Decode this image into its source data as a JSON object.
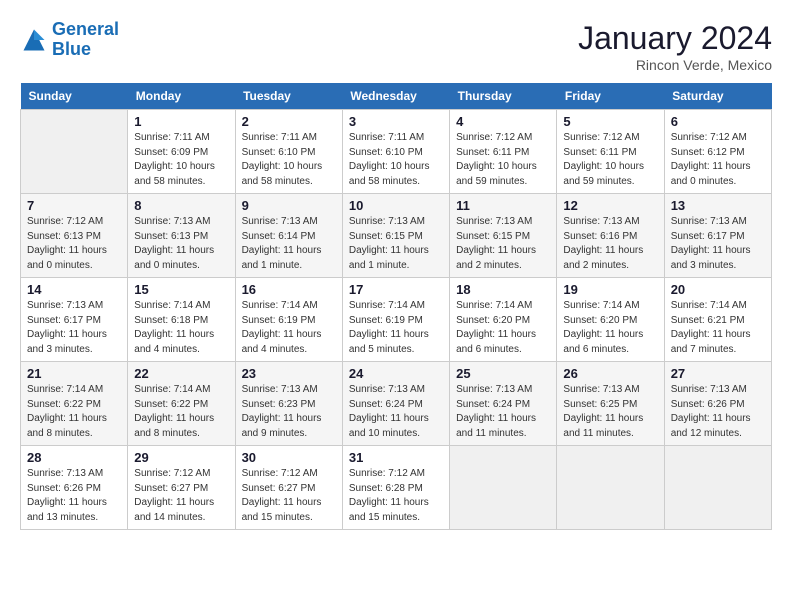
{
  "header": {
    "logo_line1": "General",
    "logo_line2": "Blue",
    "month": "January 2024",
    "location": "Rincon Verde, Mexico"
  },
  "days_of_week": [
    "Sunday",
    "Monday",
    "Tuesday",
    "Wednesday",
    "Thursday",
    "Friday",
    "Saturday"
  ],
  "weeks": [
    [
      {
        "day": "",
        "empty": true
      },
      {
        "day": "1",
        "sunrise": "7:11 AM",
        "sunset": "6:09 PM",
        "daylight": "10 hours and 58 minutes."
      },
      {
        "day": "2",
        "sunrise": "7:11 AM",
        "sunset": "6:10 PM",
        "daylight": "10 hours and 58 minutes."
      },
      {
        "day": "3",
        "sunrise": "7:11 AM",
        "sunset": "6:10 PM",
        "daylight": "10 hours and 58 minutes."
      },
      {
        "day": "4",
        "sunrise": "7:12 AM",
        "sunset": "6:11 PM",
        "daylight": "10 hours and 59 minutes."
      },
      {
        "day": "5",
        "sunrise": "7:12 AM",
        "sunset": "6:11 PM",
        "daylight": "10 hours and 59 minutes."
      },
      {
        "day": "6",
        "sunrise": "7:12 AM",
        "sunset": "6:12 PM",
        "daylight": "11 hours and 0 minutes."
      }
    ],
    [
      {
        "day": "7",
        "sunrise": "7:12 AM",
        "sunset": "6:13 PM",
        "daylight": "11 hours and 0 minutes."
      },
      {
        "day": "8",
        "sunrise": "7:13 AM",
        "sunset": "6:13 PM",
        "daylight": "11 hours and 0 minutes."
      },
      {
        "day": "9",
        "sunrise": "7:13 AM",
        "sunset": "6:14 PM",
        "daylight": "11 hours and 1 minute."
      },
      {
        "day": "10",
        "sunrise": "7:13 AM",
        "sunset": "6:15 PM",
        "daylight": "11 hours and 1 minute."
      },
      {
        "day": "11",
        "sunrise": "7:13 AM",
        "sunset": "6:15 PM",
        "daylight": "11 hours and 2 minutes."
      },
      {
        "day": "12",
        "sunrise": "7:13 AM",
        "sunset": "6:16 PM",
        "daylight": "11 hours and 2 minutes."
      },
      {
        "day": "13",
        "sunrise": "7:13 AM",
        "sunset": "6:17 PM",
        "daylight": "11 hours and 3 minutes."
      }
    ],
    [
      {
        "day": "14",
        "sunrise": "7:13 AM",
        "sunset": "6:17 PM",
        "daylight": "11 hours and 3 minutes."
      },
      {
        "day": "15",
        "sunrise": "7:14 AM",
        "sunset": "6:18 PM",
        "daylight": "11 hours and 4 minutes."
      },
      {
        "day": "16",
        "sunrise": "7:14 AM",
        "sunset": "6:19 PM",
        "daylight": "11 hours and 4 minutes."
      },
      {
        "day": "17",
        "sunrise": "7:14 AM",
        "sunset": "6:19 PM",
        "daylight": "11 hours and 5 minutes."
      },
      {
        "day": "18",
        "sunrise": "7:14 AM",
        "sunset": "6:20 PM",
        "daylight": "11 hours and 6 minutes."
      },
      {
        "day": "19",
        "sunrise": "7:14 AM",
        "sunset": "6:20 PM",
        "daylight": "11 hours and 6 minutes."
      },
      {
        "day": "20",
        "sunrise": "7:14 AM",
        "sunset": "6:21 PM",
        "daylight": "11 hours and 7 minutes."
      }
    ],
    [
      {
        "day": "21",
        "sunrise": "7:14 AM",
        "sunset": "6:22 PM",
        "daylight": "11 hours and 8 minutes."
      },
      {
        "day": "22",
        "sunrise": "7:14 AM",
        "sunset": "6:22 PM",
        "daylight": "11 hours and 8 minutes."
      },
      {
        "day": "23",
        "sunrise": "7:13 AM",
        "sunset": "6:23 PM",
        "daylight": "11 hours and 9 minutes."
      },
      {
        "day": "24",
        "sunrise": "7:13 AM",
        "sunset": "6:24 PM",
        "daylight": "11 hours and 10 minutes."
      },
      {
        "day": "25",
        "sunrise": "7:13 AM",
        "sunset": "6:24 PM",
        "daylight": "11 hours and 11 minutes."
      },
      {
        "day": "26",
        "sunrise": "7:13 AM",
        "sunset": "6:25 PM",
        "daylight": "11 hours and 11 minutes."
      },
      {
        "day": "27",
        "sunrise": "7:13 AM",
        "sunset": "6:26 PM",
        "daylight": "11 hours and 12 minutes."
      }
    ],
    [
      {
        "day": "28",
        "sunrise": "7:13 AM",
        "sunset": "6:26 PM",
        "daylight": "11 hours and 13 minutes."
      },
      {
        "day": "29",
        "sunrise": "7:12 AM",
        "sunset": "6:27 PM",
        "daylight": "11 hours and 14 minutes."
      },
      {
        "day": "30",
        "sunrise": "7:12 AM",
        "sunset": "6:27 PM",
        "daylight": "11 hours and 15 minutes."
      },
      {
        "day": "31",
        "sunrise": "7:12 AM",
        "sunset": "6:28 PM",
        "daylight": "11 hours and 15 minutes."
      },
      {
        "day": "",
        "empty": true
      },
      {
        "day": "",
        "empty": true
      },
      {
        "day": "",
        "empty": true
      }
    ]
  ],
  "labels": {
    "sunrise": "Sunrise:",
    "sunset": "Sunset:",
    "daylight": "Daylight:"
  }
}
